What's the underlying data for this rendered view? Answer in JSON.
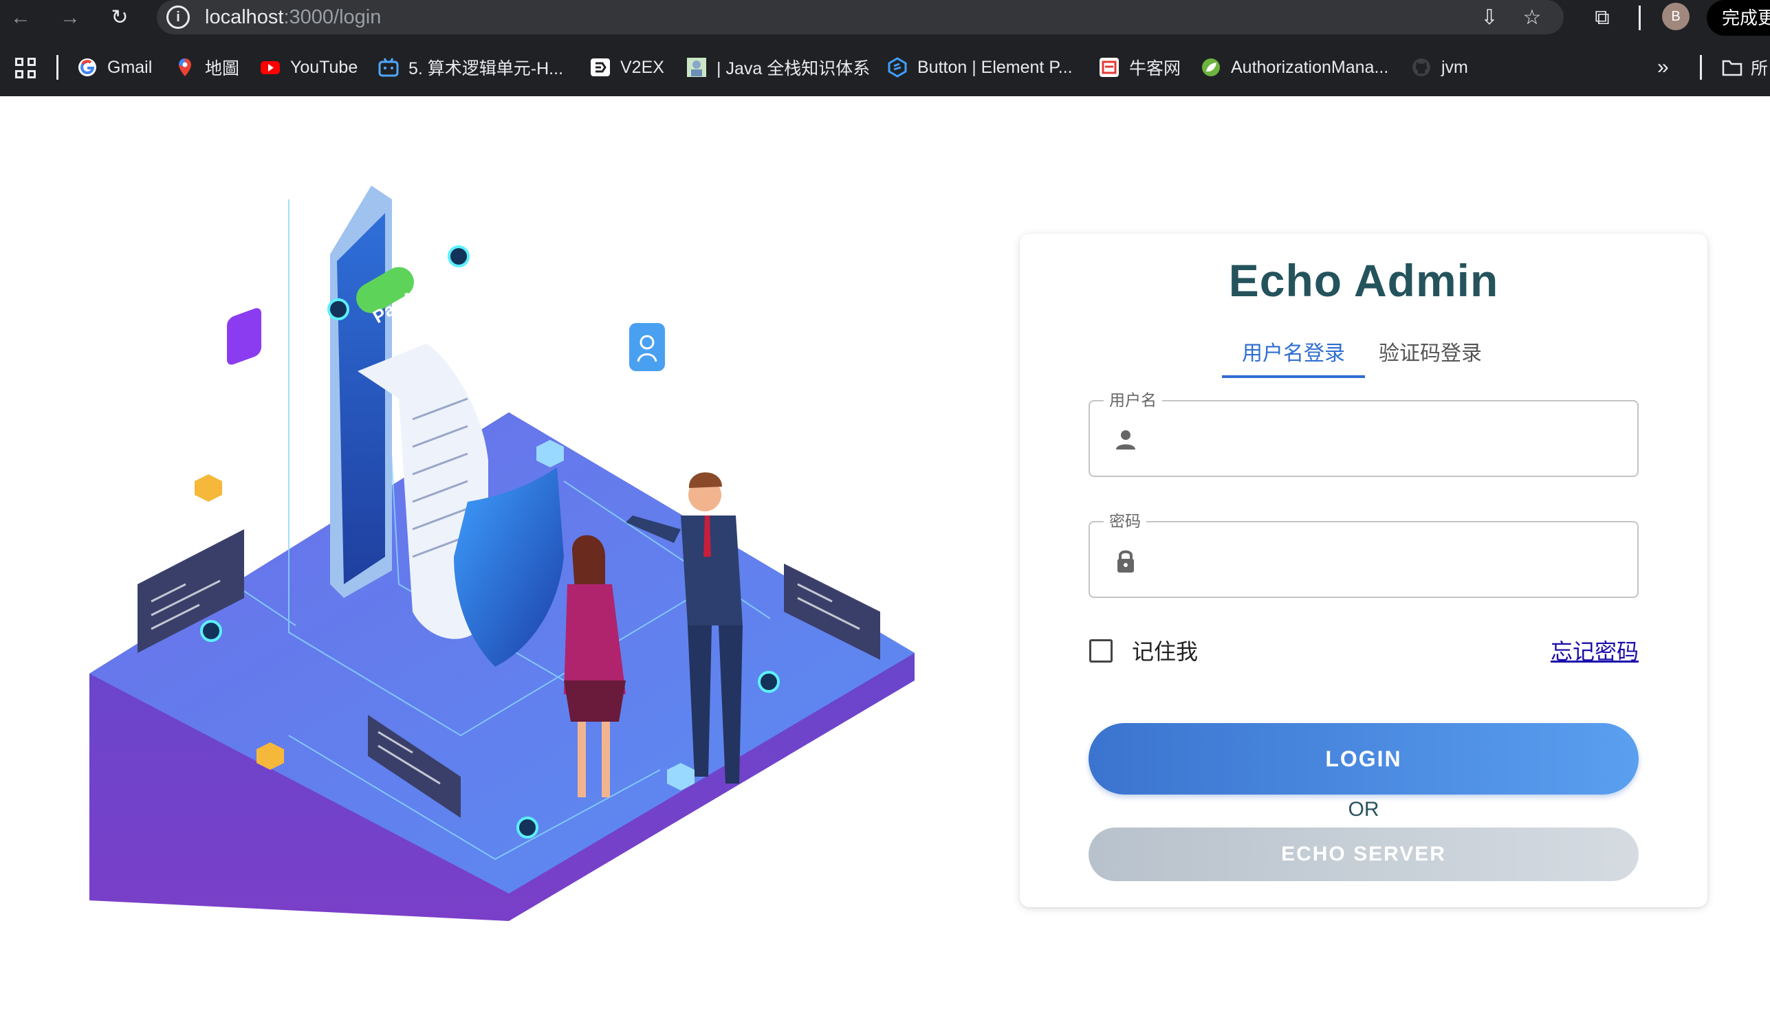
{
  "browser": {
    "url_host": "localhost",
    "url_path": ":3000/login",
    "profile_initial": "B",
    "update_label": "完成更"
  },
  "bookmarks": [
    {
      "label": "Gmail",
      "icon": "google-icon"
    },
    {
      "label": "地圖",
      "icon": "maps-icon"
    },
    {
      "label": "YouTube",
      "icon": "youtube-icon"
    },
    {
      "label": "5. 算术逻辑单元-H...",
      "icon": "bilibili-icon"
    },
    {
      "label": "V2EX",
      "icon": "v2ex-icon"
    },
    {
      "label": "| Java 全栈知识体系",
      "icon": "java-doc-icon"
    },
    {
      "label": "Button | Element P...",
      "icon": "element-plus-icon"
    },
    {
      "label": "牛客网",
      "icon": "nowcoder-icon"
    },
    {
      "label": "AuthorizationMana...",
      "icon": "spring-icon"
    },
    {
      "label": "jvm",
      "icon": "github-icon"
    }
  ],
  "bookmarks_folder": "所",
  "illustration": {
    "pay_label": "Pay Now"
  },
  "login": {
    "title": "Echo Admin",
    "tabs": [
      "用户名登录",
      "验证码登录"
    ],
    "active_tab": 0,
    "username_label": "用户名",
    "username_value": "",
    "password_label": "密码",
    "password_value": "",
    "remember_label": "记住我",
    "remember_checked": false,
    "forgot_label": "忘记密码",
    "login_button": "LOGIN",
    "or_text": "OR",
    "server_button": "ECHO SERVER"
  },
  "colors": {
    "accent": "#2f6ed1",
    "title": "#24535c",
    "login_gradient_start": "#3b74cf",
    "login_gradient_end": "#5a9ff0",
    "server_button": "#c6ced6"
  }
}
